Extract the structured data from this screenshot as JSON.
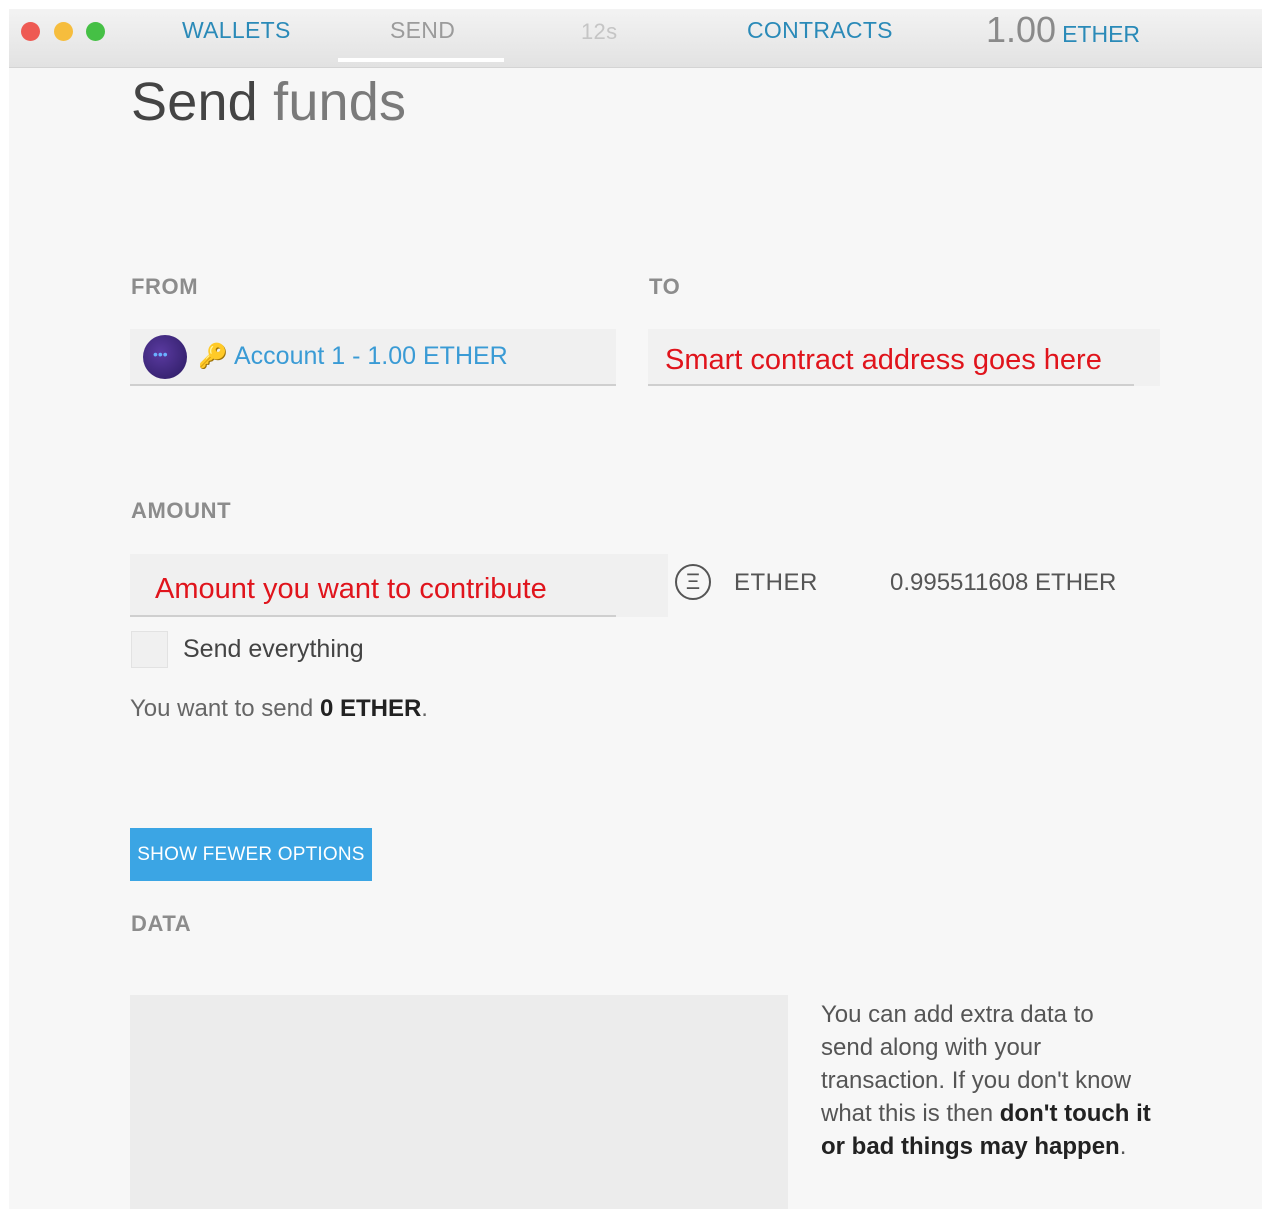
{
  "nav": {
    "wallets": "WALLETS",
    "send": "SEND",
    "timer": "12s",
    "contracts": "CONTRACTS",
    "balance_value": "1.00",
    "balance_unit": "ETHER"
  },
  "page": {
    "title_bold": "Send",
    "title_light": "funds"
  },
  "from": {
    "label": "FROM",
    "account": "Account 1 - 1.00 ETHER"
  },
  "to": {
    "label": "TO",
    "value": "Smart contract address goes here"
  },
  "amount": {
    "label": "AMOUNT",
    "value": "Amount you want to contribute",
    "unit_symbol": "Ξ",
    "unit": "ETHER",
    "available": "0.995511608 ETHER"
  },
  "send_everything": {
    "label": "Send everything",
    "checked": false
  },
  "summary": {
    "prefix": "You want to send",
    "amount": "0 ETHER",
    "suffix": "."
  },
  "options_button": "SHOW FEWER OPTIONS",
  "data": {
    "label": "DATA",
    "help_text_1": "You can add extra data to send along with your transaction. If you don't know what this is then ",
    "help_bold": "don't touch it or bad things may happen",
    "help_end": "."
  },
  "colors": {
    "accent": "#3ba5e4",
    "link": "#2a8ab8",
    "annotation_red": "#e0141c"
  }
}
